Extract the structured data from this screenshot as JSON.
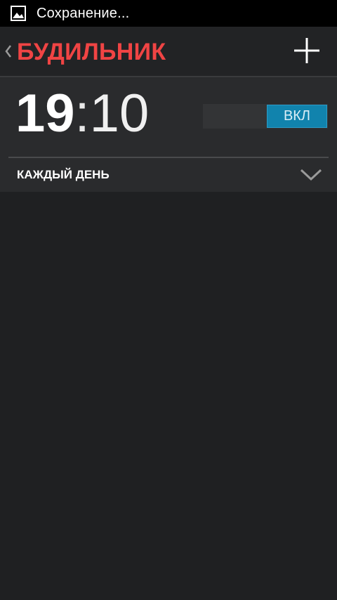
{
  "status_bar": {
    "icon": "image-icon",
    "text": "Сохранение..."
  },
  "action_bar": {
    "back_icon": "chevron-left-icon",
    "title": "БУДИЛЬНИК",
    "add_icon": "plus-icon",
    "title_color": "#f04444"
  },
  "alarm": {
    "hour": "19",
    "separator": ":",
    "minutes": "10",
    "toggle_label": "ВКЛ",
    "toggle_color": "#1183ad",
    "repeat_label": "КАЖДЫЙ ДЕНЬ",
    "expand_icon": "chevron-down-icon"
  }
}
